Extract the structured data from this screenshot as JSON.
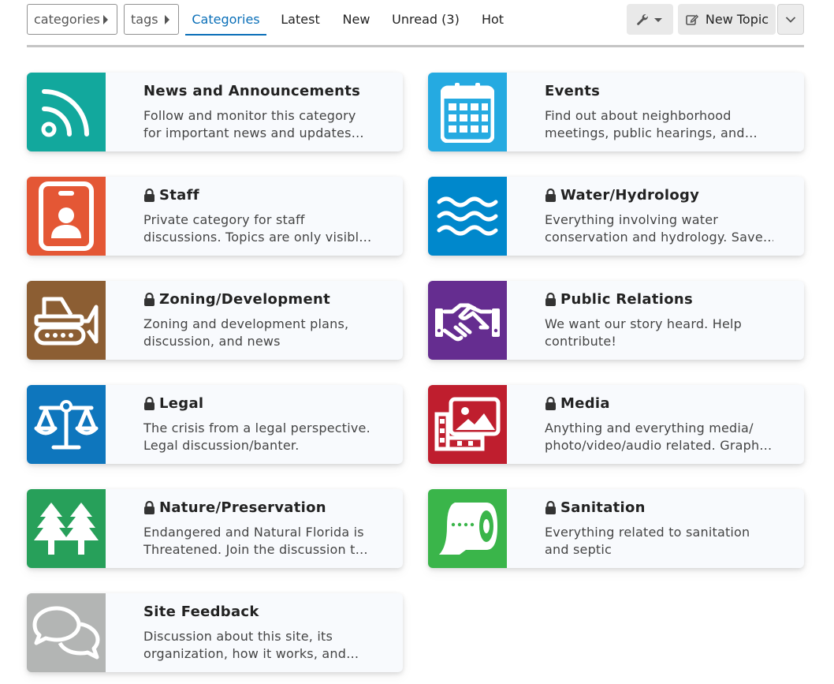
{
  "nav": {
    "categories_dropdown": "categories",
    "tags_dropdown": "tags",
    "tabs": [
      {
        "label": "Categories",
        "active": true
      },
      {
        "label": "Latest"
      },
      {
        "label": "New"
      },
      {
        "label": "Unread (3)"
      },
      {
        "label": "Hot"
      }
    ],
    "new_topic_label": "New Topic",
    "wrench_icon": "wrench-icon",
    "more_icon": "chevron-down-icon"
  },
  "categories": [
    {
      "title": "News and Announcements",
      "locked": false,
      "desc1": "Follow and monitor this category",
      "desc2": "for important news and updates…",
      "color": "#12a89d",
      "icon": "rss-icon"
    },
    {
      "title": "Events",
      "locked": false,
      "desc1": "Find out about neighborhood",
      "desc2": "meetings, public hearings, and…",
      "color": "#25aae1",
      "icon": "calendar-icon"
    },
    {
      "title": "Staff",
      "locked": true,
      "desc1": "Private category for staff",
      "desc2": "discussions. Topics are only visibl…",
      "color": "#e45735",
      "icon": "id-badge-icon"
    },
    {
      "title": "Water/Hydrology",
      "locked": true,
      "desc1": "Everything involving water",
      "desc2": "conservation and hydrology. Save…",
      "color": "#0088cc",
      "icon": "water-icon"
    },
    {
      "title": "Zoning/Development",
      "locked": true,
      "desc1": "Zoning and development plans,",
      "desc2": "discussion, and news",
      "color": "#8c5e33",
      "icon": "bulldozer-icon"
    },
    {
      "title": "Public Relations",
      "locked": true,
      "desc1": "We want our story heard. Help",
      "desc2": "contribute!",
      "color": "#652d90",
      "icon": "handshake-icon"
    },
    {
      "title": "Legal",
      "locked": true,
      "desc1": "The crisis from a legal perspective.",
      "desc2": "Legal discussion/banter.",
      "color": "#0e76bd",
      "icon": "balance-scale-icon"
    },
    {
      "title": "Media",
      "locked": true,
      "desc1": "Anything and everything media/",
      "desc2": "photo/video/audio related. Graph…",
      "color": "#bf1e2e",
      "icon": "photo-video-icon"
    },
    {
      "title": "Nature/Preservation",
      "locked": true,
      "desc1": "Endangered and Natural Florida is",
      "desc2": "Threatened. Join the discussion t…",
      "color": "#27a05a",
      "icon": "trees-icon"
    },
    {
      "title": "Sanitation",
      "locked": true,
      "desc1": "Everything related to sanitation",
      "desc2": "and septic",
      "color": "#3ab54a",
      "icon": "toilet-paper-icon"
    },
    {
      "title": "Site Feedback",
      "locked": false,
      "desc1": "Discussion about this site, its",
      "desc2": "organization, how it works, and…",
      "color": "#b3b5b4",
      "icon": "comments-icon"
    }
  ]
}
